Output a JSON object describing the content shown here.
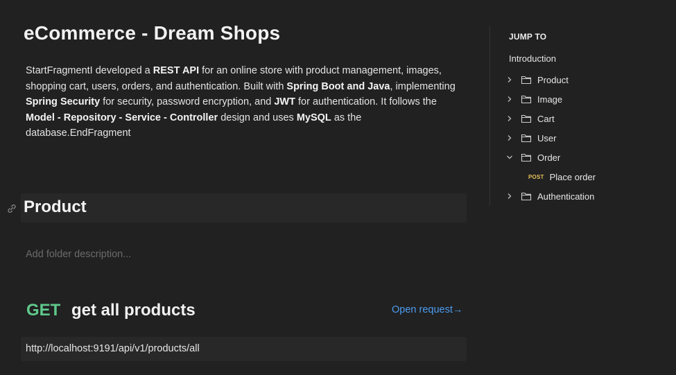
{
  "doc": {
    "title": "eCommerce - Dream Shops",
    "intro": [
      {
        "t": "StartFragmentI developed a ",
        "b": false
      },
      {
        "t": "REST API",
        "b": true
      },
      {
        "t": " for an online store with product management, images, shopping cart, users, orders, and authentication. Built with ",
        "b": false
      },
      {
        "t": "Spring Boot and Java",
        "b": true
      },
      {
        "t": ", implementing ",
        "b": false
      },
      {
        "t": "Spring Security",
        "b": true
      },
      {
        "t": " for security, password encryption, and ",
        "b": false
      },
      {
        "t": "JWT",
        "b": true
      },
      {
        "t": " for authentication. It follows the ",
        "b": false
      },
      {
        "t": "Model - Repository - Service - Controller",
        "b": true
      },
      {
        "t": " design and uses ",
        "b": false
      },
      {
        "t": "MySQL",
        "b": true
      },
      {
        "t": " as the database.EndFragment",
        "b": false
      }
    ]
  },
  "folder": {
    "title": "Product",
    "description_placeholder": "Add folder description..."
  },
  "request": {
    "method": "GET",
    "name": "get all products",
    "open_label": "Open request",
    "url": "http://localhost:9191/api/v1/products/all",
    "method_color": "#5fc98b"
  },
  "toc": {
    "heading": "JUMP TO",
    "intro": "Introduction",
    "items": [
      {
        "label": "Product",
        "expanded": false,
        "icon": "folder-icon"
      },
      {
        "label": "Image",
        "expanded": false,
        "icon": "folder-icon"
      },
      {
        "label": "Cart",
        "expanded": false,
        "icon": "folder-icon"
      },
      {
        "label": "User",
        "expanded": false,
        "icon": "folder-icon"
      },
      {
        "label": "Order",
        "expanded": true,
        "icon": "folder-icon"
      },
      {
        "label": "Authentication",
        "expanded": false,
        "icon": "folder-icon"
      }
    ],
    "sub": {
      "method": "POST",
      "label": "Place order"
    }
  }
}
